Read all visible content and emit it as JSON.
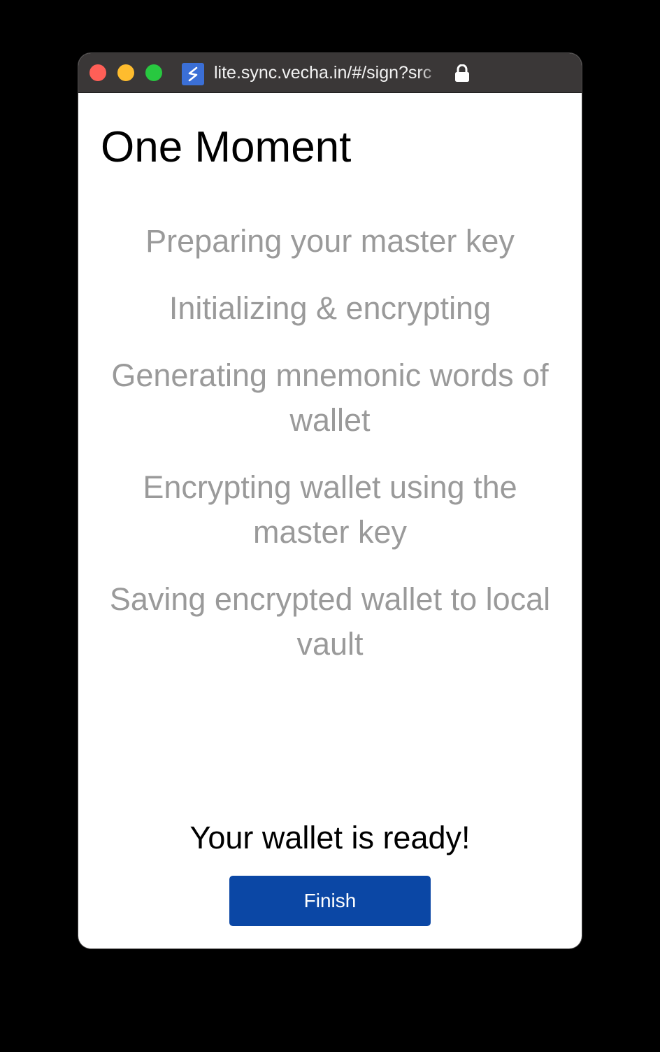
{
  "browser": {
    "url": "lite.sync.vecha.in/#/sign?src",
    "favicon": "sync-icon",
    "lock_icon": "lock-icon"
  },
  "page": {
    "title": "One Moment",
    "steps": [
      "Preparing your master key",
      "Initializing & encrypting",
      "Generating mnemonic words of wallet",
      "Encrypting wallet using the master key",
      "Saving encrypted wallet to local vault"
    ],
    "status": "Your wallet is ready!",
    "finish_label": "Finish"
  },
  "colors": {
    "titlebar": "#3a3737",
    "accent": "#0b47a5",
    "step_text": "#9a9a9a"
  }
}
